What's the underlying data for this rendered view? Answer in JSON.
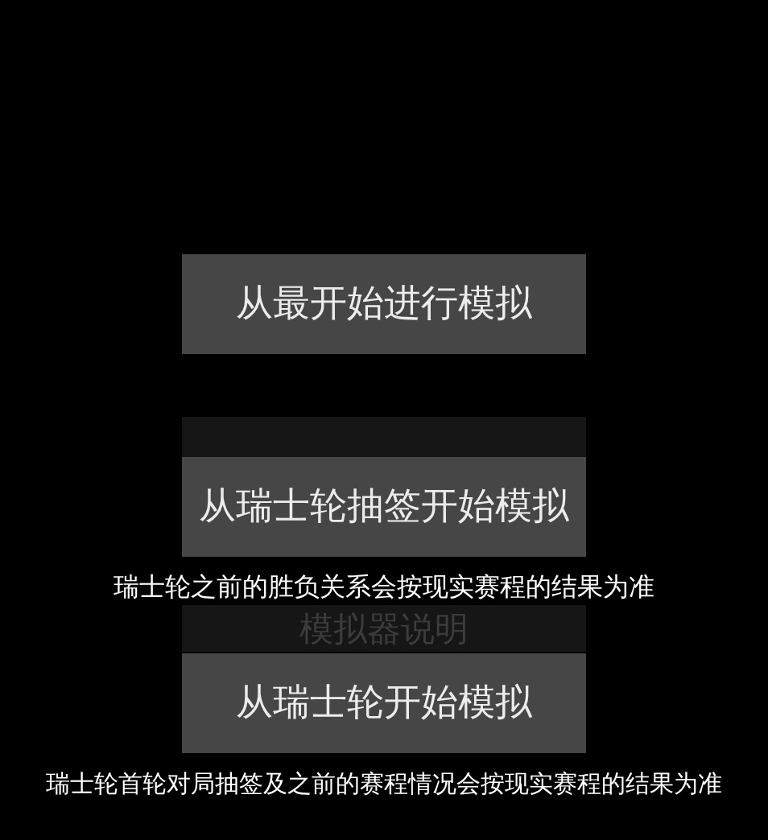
{
  "background_menu": [
    {
      "label": "模拟器说明"
    }
  ],
  "dialog": {
    "options": [
      {
        "label": "从最开始进行模拟"
      },
      {
        "label": "从瑞士轮抽签开始模拟",
        "note": "瑞士轮之前的胜负关系会按现实赛程的结果为准"
      },
      {
        "label": "从瑞士轮开始模拟",
        "note": "瑞士轮首轮对局抽签及之前的赛程情况会按现实赛程的结果为准"
      }
    ]
  }
}
